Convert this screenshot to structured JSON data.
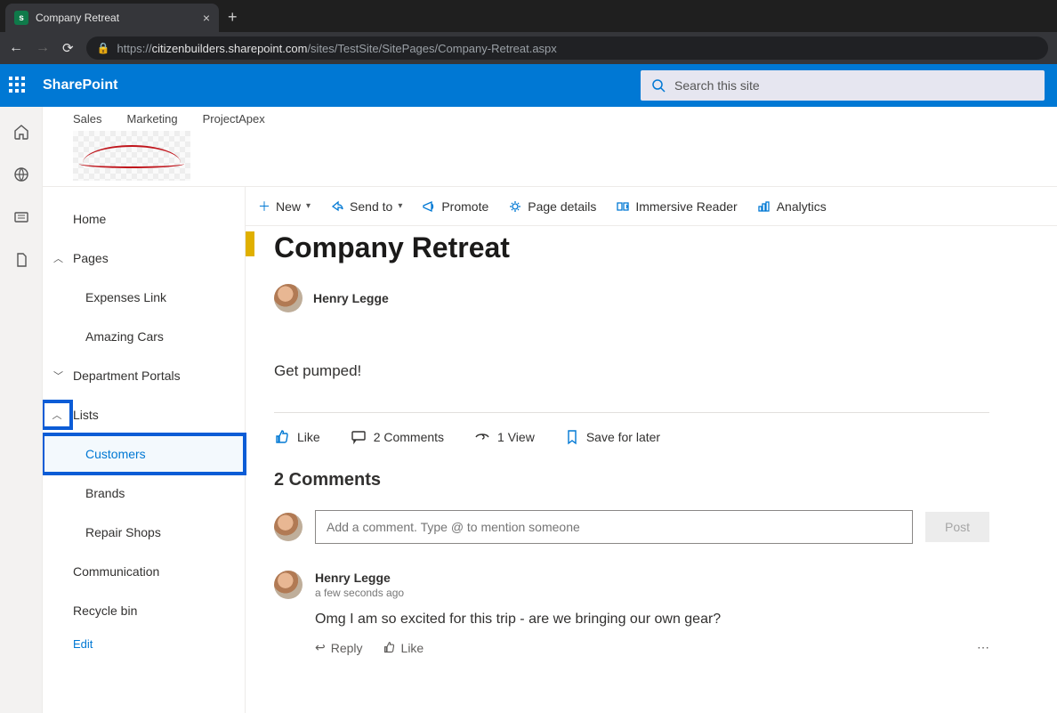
{
  "browser": {
    "tab_title": "Company Retreat",
    "url_prefix": "https://",
    "url_domain": "citizenbuilders.sharepoint.com",
    "url_path": "/sites/TestSite/SitePages/Company-Retreat.aspx"
  },
  "suite": {
    "brand": "SharePoint",
    "search_placeholder": "Search this site"
  },
  "site_header": {
    "nav": [
      "Sales",
      "Marketing",
      "ProjectApex"
    ]
  },
  "left_nav": {
    "home": "Home",
    "pages": "Pages",
    "pages_children": [
      "Expenses Link",
      "Amazing Cars"
    ],
    "dept": "Department Portals",
    "lists": "Lists",
    "lists_children": [
      "Customers",
      "Brands",
      "Repair Shops"
    ],
    "communication": "Communication",
    "recycle": "Recycle bin",
    "edit": "Edit"
  },
  "cmd_bar": {
    "new": "New",
    "send_to": "Send to",
    "promote": "Promote",
    "page_details": "Page details",
    "immersive": "Immersive Reader",
    "analytics": "Analytics"
  },
  "page": {
    "title": "Company Retreat",
    "author": "Henry Legge",
    "body": "Get pumped!",
    "like": "Like",
    "comments_count": "2 Comments",
    "views": "1 View",
    "save": "Save for later",
    "comments_header": "2 Comments",
    "comment_placeholder": "Add a comment. Type @ to mention someone",
    "post": "Post"
  },
  "comments": [
    {
      "name": "Henry Legge",
      "time": "a few seconds ago",
      "text": "Omg I am so excited for this trip - are we bringing our own gear?",
      "reply": "Reply",
      "like": "Like"
    }
  ]
}
